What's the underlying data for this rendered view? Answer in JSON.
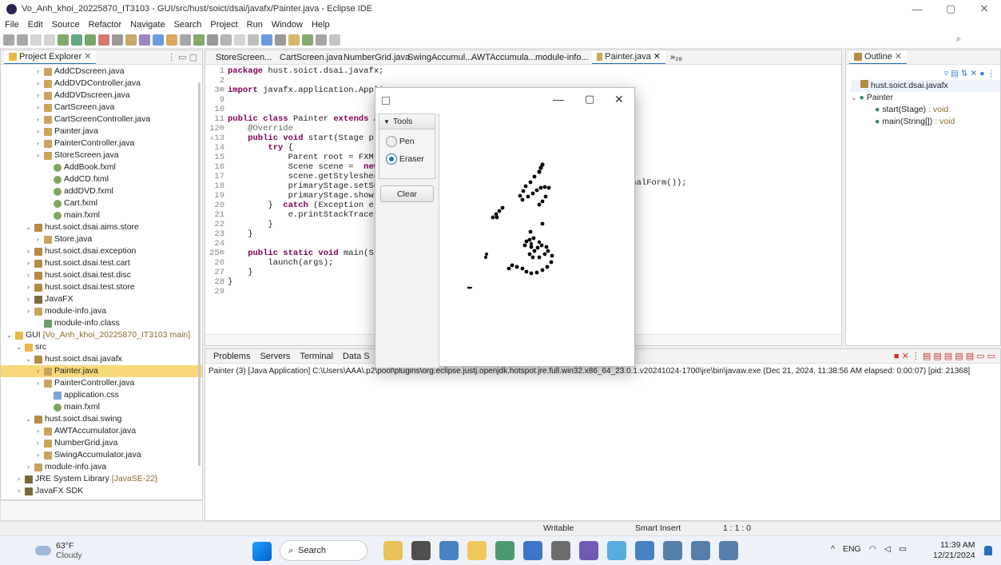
{
  "window": {
    "title": "Vo_Anh_khoi_20225870_IT3103 - GUI/src/hust/soict/dsai/javafx/Painter.java - Eclipse IDE",
    "min": "—",
    "max": "▢",
    "close": "✕"
  },
  "menu": [
    "File",
    "Edit",
    "Source",
    "Refactor",
    "Navigate",
    "Search",
    "Project",
    "Run",
    "Window",
    "Help"
  ],
  "project_explorer": {
    "tab": "Project Explorer",
    "rows": [
      {
        "label": "AddCDscreen.java",
        "indent": 3,
        "icon": "java",
        "arrow": "›"
      },
      {
        "label": "AddDVDController.java",
        "indent": 3,
        "icon": "java",
        "arrow": "›"
      },
      {
        "label": "AddDVDscreen.java",
        "indent": 3,
        "icon": "java",
        "arrow": "›"
      },
      {
        "label": "CartScreen.java",
        "indent": 3,
        "icon": "java",
        "arrow": "›"
      },
      {
        "label": "CartScreenController.java",
        "indent": 3,
        "icon": "java",
        "arrow": "›"
      },
      {
        "label": "Painter.java",
        "indent": 3,
        "icon": "java",
        "arrow": "›"
      },
      {
        "label": "PainterController.java",
        "indent": 3,
        "icon": "java",
        "arrow": "›"
      },
      {
        "label": "StoreScreen.java",
        "indent": 3,
        "icon": "java",
        "arrow": "›"
      },
      {
        "label": "AddBook.fxml",
        "indent": 4,
        "icon": "fx",
        "arrow": ""
      },
      {
        "label": "AddCD.fxml",
        "indent": 4,
        "icon": "fx",
        "arrow": ""
      },
      {
        "label": "addDVD.fxml",
        "indent": 4,
        "icon": "fx",
        "arrow": ""
      },
      {
        "label": "Cart.fxml",
        "indent": 4,
        "icon": "fx",
        "arrow": ""
      },
      {
        "label": "main.fxml",
        "indent": 4,
        "icon": "fx",
        "arrow": ""
      },
      {
        "label": "hust.soict.dsai.aims.store",
        "indent": 2,
        "icon": "pkg",
        "arrow": "⌄"
      },
      {
        "label": "Store.java",
        "indent": 3,
        "icon": "java",
        "arrow": "›"
      },
      {
        "label": "hust.soict.dsai.exception",
        "indent": 2,
        "icon": "pkg",
        "arrow": "›"
      },
      {
        "label": "hust.soict.dsai.test.cart",
        "indent": 2,
        "icon": "pkg",
        "arrow": "›"
      },
      {
        "label": "hust.soict.dsai.test.disc",
        "indent": 2,
        "icon": "pkg",
        "arrow": "›"
      },
      {
        "label": "hust.soict.dsai.test.store",
        "indent": 2,
        "icon": "pkg",
        "arrow": "›"
      },
      {
        "label": "JavaFX",
        "indent": 2,
        "icon": "lib",
        "arrow": "›"
      },
      {
        "label": "module-info.java",
        "indent": 2,
        "icon": "java",
        "arrow": "›"
      },
      {
        "label": "module-info.class",
        "indent": 3,
        "icon": "cls",
        "arrow": ""
      },
      {
        "label": "GUI",
        "suffix": "[Vo_Anh_khoi_20225870_IT3103 main]",
        "indent": 0,
        "icon": "folder",
        "arrow": "⌄"
      },
      {
        "label": "src",
        "indent": 1,
        "icon": "folder",
        "arrow": "⌄"
      },
      {
        "label": "hust.soict.dsai.javafx",
        "indent": 2,
        "icon": "pkg",
        "arrow": "⌄"
      },
      {
        "label": "Painter.java",
        "indent": 3,
        "icon": "java",
        "arrow": "›",
        "selected": true
      },
      {
        "label": "PainterController.java",
        "indent": 3,
        "icon": "java",
        "arrow": "›"
      },
      {
        "label": "application.css",
        "indent": 4,
        "icon": "css",
        "arrow": ""
      },
      {
        "label": "main.fxml",
        "indent": 4,
        "icon": "fx",
        "arrow": ""
      },
      {
        "label": "hust.soict.dsai.swing",
        "indent": 2,
        "icon": "pkg",
        "arrow": "⌄"
      },
      {
        "label": "AWTAccumulator.java",
        "indent": 3,
        "icon": "java",
        "arrow": "›"
      },
      {
        "label": "NumberGrid.java",
        "indent": 3,
        "icon": "java",
        "arrow": "›"
      },
      {
        "label": "SwingAccumulator.java",
        "indent": 3,
        "icon": "java",
        "arrow": "›"
      },
      {
        "label": "module-info.java",
        "indent": 2,
        "icon": "java",
        "arrow": "›"
      },
      {
        "label": "JRE System Library",
        "suffix": "[JavaSE-22]",
        "indent": 1,
        "icon": "lib",
        "arrow": "›"
      },
      {
        "label": "JavaFX SDK",
        "indent": 1,
        "icon": "lib",
        "arrow": "›"
      },
      {
        "label": "JavaFX",
        "indent": 1,
        "icon": "lib",
        "arrow": "›"
      }
    ]
  },
  "editor_tabs": [
    "StoreScreen...",
    "CartScreen.java",
    "NumberGrid.java",
    "SwingAccumul...",
    "AWTAccumula...",
    "module-info...",
    "Painter.java"
  ],
  "editor_more": "»₂₈",
  "code_lines": [
    {
      "n": "1",
      "t": [
        [
          "kw",
          "package"
        ],
        [
          "",
          "hust.soict.dsai.javafx;"
        ]
      ]
    },
    {
      "n": "2",
      "t": []
    },
    {
      "n": "3⊕",
      "t": [
        [
          "kw",
          "import"
        ],
        [
          "",
          "javafx.application.Applic"
        ]
      ]
    },
    {
      "n": "9",
      "t": []
    },
    {
      "n": "10",
      "t": []
    },
    {
      "n": "11",
      "t": [
        [
          "kw",
          "public class"
        ],
        [
          "",
          "Painter"
        ],
        [
          "kw",
          "extends"
        ],
        [
          "",
          "Ap"
        ]
      ]
    },
    {
      "n": "12⊖",
      "t": [
        [
          "ann",
          "    @Override"
        ]
      ]
    },
    {
      "n": "▵13",
      "t": [
        [
          "kw",
          "    public void"
        ],
        [
          "",
          "start(Stage pri"
        ]
      ]
    },
    {
      "n": "14",
      "t": [
        [
          "kw",
          "        try"
        ],
        [
          "",
          "{"
        ]
      ]
    },
    {
      "n": "15",
      "t": [
        [
          "",
          "            Parent root = FXMLL"
        ]
      ]
    },
    {
      "n": "16",
      "t": [
        [
          "",
          "            Scene scene = "
        ],
        [
          "kw",
          "new"
        ],
        [
          "",
          "S"
        ]
      ]
    },
    {
      "n": "17",
      "t": [
        [
          "",
          "            scene.getStylesheet"
        ]
      ]
    },
    {
      "n": "18",
      "t": [
        [
          "",
          "            primaryStage.setSce"
        ]
      ]
    },
    {
      "n": "19",
      "t": [
        [
          "",
          "            primaryStage.show()"
        ]
      ]
    },
    {
      "n": "20",
      "t": [
        [
          "",
          "        } "
        ],
        [
          "kw",
          "catch"
        ],
        [
          "",
          "(Exception e) {"
        ]
      ]
    },
    {
      "n": "21",
      "t": [
        [
          "",
          "            e.printStackTrace()"
        ]
      ]
    },
    {
      "n": "22",
      "t": [
        [
          "",
          "        }"
        ]
      ]
    },
    {
      "n": "23",
      "t": [
        [
          "",
          "    }"
        ]
      ]
    },
    {
      "n": "24",
      "t": []
    },
    {
      "n": "25⊖",
      "t": [
        [
          "kw",
          "    public static void"
        ],
        [
          "",
          "main(Str"
        ]
      ]
    },
    {
      "n": "26",
      "t": [
        [
          "",
          "        launch(args);"
        ]
      ]
    },
    {
      "n": "27",
      "t": [
        [
          "",
          "    }"
        ]
      ]
    },
    {
      "n": "28",
      "t": [
        [
          "",
          "}"
        ]
      ]
    },
    {
      "n": "29",
      "t": []
    }
  ],
  "code_tail": "rnalForm());",
  "outline": {
    "tab": "Outline",
    "package": "hust.soict.dsai.javafx",
    "class": "Painter",
    "members": [
      {
        "name": "start(Stage)",
        "type": " : void"
      },
      {
        "name": "main(String[])",
        "type": " : void"
      }
    ]
  },
  "bottom_tabs": [
    "Problems",
    "Servers",
    "Terminal",
    "Data S"
  ],
  "console_line": "Painter (3) [Java Application] C:\\Users\\AAA\\.p2\\pool\\plugins\\org.eclipse.justj.openjdk.hotspot.jre.full.win32.x86_64_23.0.1.v20241024-1700\\jre\\bin\\javaw.exe  (Dec 21, 2024, 11:38:56 AM elapsed: 0:00:07) [pid: 21368]",
  "status": {
    "writable": "Writable",
    "insert": "Smart Insert",
    "position": "1 : 1 : 0"
  },
  "fx_window": {
    "tools_label": "Tools",
    "pen": "Pen",
    "eraser": "Eraser",
    "clear": "Clear",
    "selected_tool": "Eraser"
  },
  "taskbar": {
    "weather_temp": "63°F",
    "weather_desc": "Cloudy",
    "search": "Search",
    "lang": "ENG",
    "time": "11:39 AM",
    "date": "12/21/2024"
  }
}
